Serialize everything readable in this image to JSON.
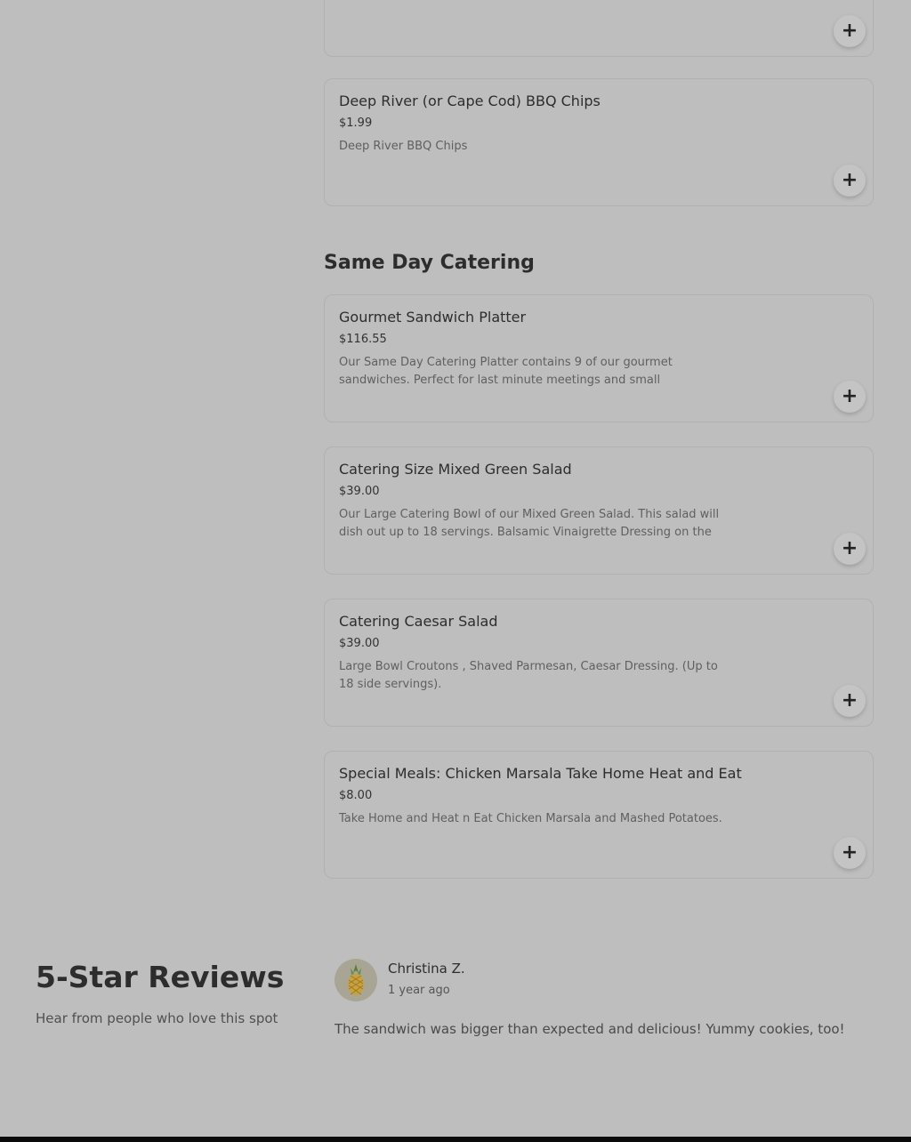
{
  "menu": {
    "top_card": {
      "add_label": "+"
    },
    "chips_item": {
      "name": "Deep River (or Cape Cod) BBQ Chips",
      "price": "$1.99",
      "description": "Deep River BBQ Chips",
      "add_label": "+"
    },
    "catering_section": {
      "title": "Same Day Catering",
      "items": [
        {
          "name": "Gourmet Sandwich Platter",
          "price": "$116.55",
          "description": "Our Same Day Catering Platter contains 9 of our gourmet sandwiches. Perfect for last minute meetings and small gatherings....",
          "add_label": "+"
        },
        {
          "name": "Catering Size Mixed Green Salad",
          "price": "$39.00",
          "description": "Our Large Catering Bowl of our Mixed Green Salad. This salad will dish out up to 18 servings. Balsamic Vinaigrette Dressing on the side.",
          "add_label": "+"
        },
        {
          "name": "Catering Caesar Salad",
          "price": "$39.00",
          "description": "Large Bowl Croutons , Shaved Parmesan, Caesar Dressing. (Up to 18 side servings).",
          "add_label": "+"
        },
        {
          "name": "Special Meals: Chicken Marsala Take Home Heat and Eat",
          "price": "$8.00",
          "description": "Take Home and Heat n Eat Chicken Marsala and Mashed Potatoes.",
          "add_label": "+"
        }
      ]
    }
  },
  "reviews": {
    "title": "5-Star Reviews",
    "subtitle": "Hear from people who love this spot",
    "items": [
      {
        "avatar_icon": "pineapple-icon",
        "name": "Christina Z.",
        "time": "1 year ago",
        "text": "The sandwich was bigger than expected and delicious! Yummy cookies, too!"
      }
    ]
  },
  "colors": {
    "overlay_background": "#bebebe",
    "text_primary": "#2d2d2d",
    "text_secondary": "#606060",
    "card_border": "#b1b1b1",
    "bottom_bar": "#0a0a0a"
  }
}
